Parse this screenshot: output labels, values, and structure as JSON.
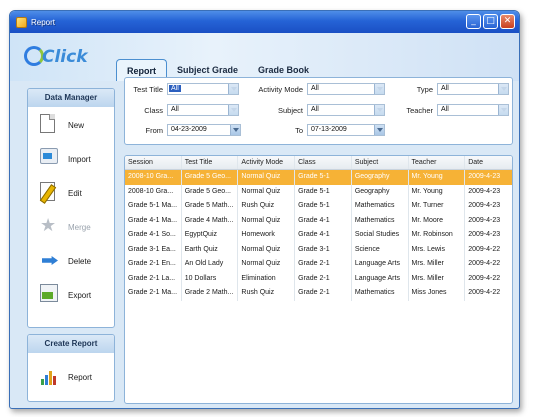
{
  "window": {
    "title": "Report"
  },
  "logo": {
    "text": "Click"
  },
  "tabs": [
    {
      "label": "Report",
      "active": true
    },
    {
      "label": "Subject Grade",
      "active": false
    },
    {
      "label": "Grade Book",
      "active": false
    }
  ],
  "sidebar": {
    "data_manager_title": "Data Manager",
    "items": [
      {
        "label": "New",
        "icon": "new-document-icon",
        "enabled": true
      },
      {
        "label": "Import",
        "icon": "import-icon",
        "enabled": true
      },
      {
        "label": "Edit",
        "icon": "edit-pencil-icon",
        "enabled": true
      },
      {
        "label": "Merge",
        "icon": "merge-star-icon",
        "enabled": false
      },
      {
        "label": "Delete",
        "icon": "delete-arrow-icon",
        "enabled": true
      },
      {
        "label": "Export",
        "icon": "export-icon",
        "enabled": true
      }
    ],
    "create_report_title": "Create Report",
    "report_label": "Report"
  },
  "filters": {
    "test_title_label": "Test Title",
    "test_title_value": "All",
    "activity_mode_label": "Activity Mode",
    "activity_mode_value": "All",
    "type_label": "Type",
    "type_value": "All",
    "class_label": "Class",
    "class_value": "All",
    "subject_label": "Subject",
    "subject_value": "All",
    "teacher_label": "Teacher",
    "teacher_value": "All",
    "from_label": "From",
    "from_value": "04-23-2009",
    "to_label": "To",
    "to_value": "07-13-2009"
  },
  "table": {
    "headers": [
      "Session",
      "Test Title",
      "Activity Mode",
      "Class",
      "Subject",
      "Teacher",
      "Date"
    ],
    "rows": [
      [
        "2008-10 Gra...",
        "Grade 5 Geo...",
        "Normal Quiz",
        "Grade 5-1",
        "Geography",
        "Mr. Young",
        "2009-4-23"
      ],
      [
        "2008-10 Gra...",
        "Grade 5 Geo...",
        "Normal Quiz",
        "Grade 5-1",
        "Geography",
        "Mr. Young",
        "2009-4-23"
      ],
      [
        "Grade 5-1 Ma...",
        "Grade 5 Math...",
        "Rush Quiz",
        "Grade 5-1",
        "Mathematics",
        "Mr. Turner",
        "2009-4-23"
      ],
      [
        "Grade 4-1 Ma...",
        "Grade 4 Math...",
        "Normal Quiz",
        "Grade 4-1",
        "Mathematics",
        "Mr. Moore",
        "2009-4-23"
      ],
      [
        "Grade 4-1 So...",
        "EgyptQuiz",
        "Homework",
        "Grade 4-1",
        "Social Studies",
        "Mr. Robinson",
        "2009-4-23"
      ],
      [
        "Grade 3-1 Ea...",
        "Earth Quiz",
        "Normal Quiz",
        "Grade 3-1",
        "Science",
        "Mrs. Lewis",
        "2009-4-22"
      ],
      [
        "Grade 2-1 En...",
        "An Old Lady",
        "Normal Quiz",
        "Grade 2-1",
        "Language Arts",
        "Mrs. Miller",
        "2009-4-22"
      ],
      [
        "Grade 2-1 La...",
        "10 Dollars",
        "Elimination",
        "Grade 2-1",
        "Language Arts",
        "Mrs. Miller",
        "2009-4-22"
      ],
      [
        "Grade 2-1 Ma...",
        "Grade 2 Math...",
        "Rush Quiz",
        "Grade 2-1",
        "Mathematics",
        "Miss Jones",
        "2009-4-22"
      ]
    ],
    "selected_row": 0
  },
  "colors": {
    "selection": "#f6b236",
    "titlebar": "#2563d6",
    "background": "#d9e8f6"
  }
}
